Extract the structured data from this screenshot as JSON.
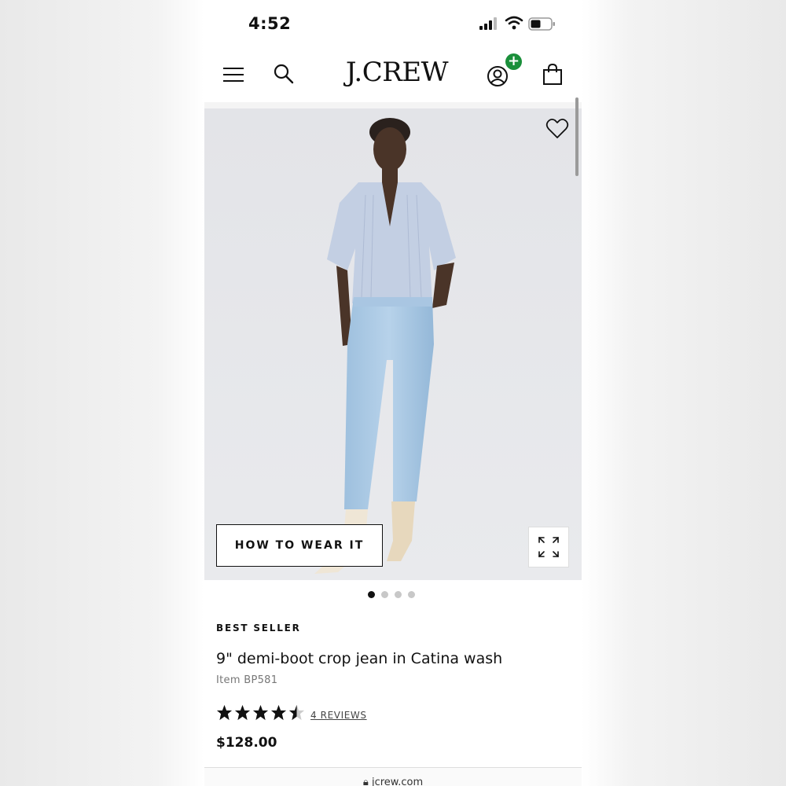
{
  "status_bar": {
    "time": "4:52"
  },
  "header": {
    "logo": "J.CREW",
    "badge": "+"
  },
  "hero": {
    "cta_label": "HOW TO WEAR IT",
    "carousel_total": 4,
    "carousel_active": 1
  },
  "product": {
    "tag": "BEST SELLER",
    "name": "9\" demi-boot crop jean in Catina wash",
    "item": "Item BP581",
    "rating": 4.5,
    "rating_max": 5,
    "reviews_label": "4 REVIEWS",
    "price": "$128.00"
  },
  "browser": {
    "url": "jcrew.com"
  },
  "colors": {
    "badge": "#1a8f3a",
    "text": "#111111",
    "hero_bg": "#e6e7ea"
  }
}
